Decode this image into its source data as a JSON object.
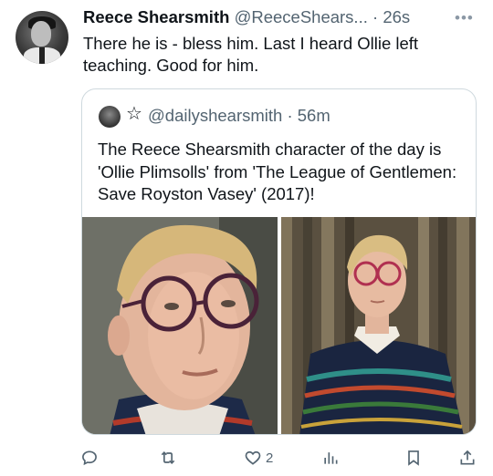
{
  "tweet": {
    "author_name": "Reece Shearsmith",
    "author_handle": "@ReeceShears...",
    "separator": "·",
    "time": "26s",
    "text": "There he is - bless him. Last I heard Ollie left teaching. Good for him."
  },
  "quoted_tweet": {
    "handle": "@dailyshearsmith",
    "separator": "·",
    "time": "56m",
    "text": "The Reece Shearsmith character of the day is 'Ollie Plimsolls' from 'The League of Gentlemen: Save Royston Vasey' (2017)!"
  },
  "actions": {
    "reply_count": "",
    "repost_count": "",
    "like_count": "2",
    "views_count": ""
  },
  "icons": {
    "more": "more-icon",
    "reply": "reply-icon",
    "repost": "repost-icon",
    "like": "heart-icon",
    "views": "views-icon",
    "bookmark": "bookmark-icon",
    "share": "share-icon",
    "star": "star-icon"
  }
}
